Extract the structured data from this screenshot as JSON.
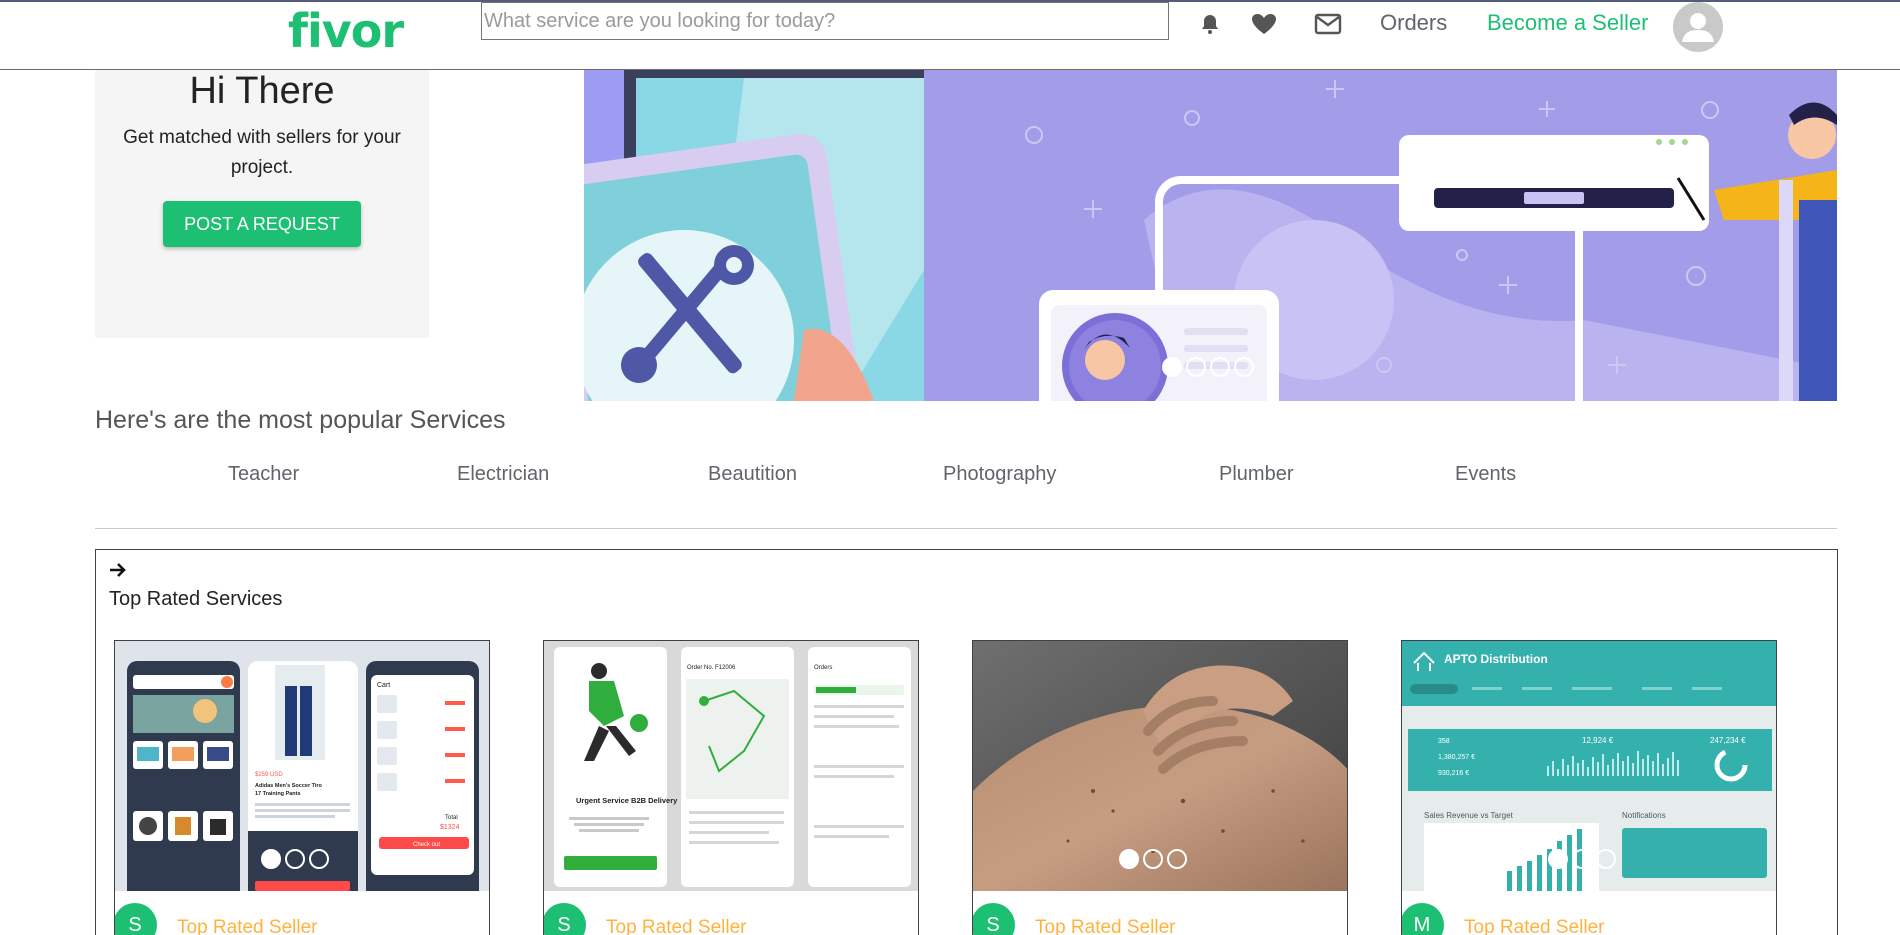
{
  "header": {
    "logo": "fivor",
    "search_placeholder": "What service are you looking for today?",
    "icons": [
      "bell-icon",
      "heart-icon",
      "mail-icon"
    ],
    "orders_label": "Orders",
    "become_seller_label": "Become a Seller",
    "brand_color": "#1dbf73"
  },
  "hero": {
    "title": "Hi There",
    "subtitle": "Get matched with sellers for your project.",
    "button_label": "POST A REQUEST",
    "slides": 4,
    "active_slide": 0
  },
  "popular": {
    "title": "Here's are the most popular Services",
    "categories": [
      "Teacher",
      "Electrician",
      "Beautition",
      "Photography",
      "Plumber",
      "Events"
    ]
  },
  "top_rated": {
    "title": "Top Rated Services",
    "cards": [
      {
        "avatar": "S",
        "label": "Top Rated Seller",
        "avatar_color": "#1dbf73"
      },
      {
        "avatar": "S",
        "label": "Top Rated Seller",
        "avatar_color": "#1dbf73"
      },
      {
        "avatar": "S",
        "label": "Top Rated Seller",
        "avatar_color": "#1dbf73"
      },
      {
        "avatar": "M",
        "label": "Top Rated Seller",
        "avatar_color": "#1dbf73"
      }
    ],
    "analytics_card": {
      "brand": "APTO Distribution",
      "kpi_1": "358",
      "kpi_2": "1,380,257 €",
      "kpi_3": "930,216 €",
      "kpi_4": "12,924 €",
      "kpi_5": "247,234 €",
      "chart_title": "Sales Revenue vs Target",
      "notifications": "Notifications"
    },
    "shop_card": {
      "cart_title": "Cart",
      "price": "$259 USD",
      "product": "Adidas Men's Soccer Tiro 17 Training Pants",
      "total_label": "Total",
      "total": "$1324",
      "checkout": "Check out"
    },
    "delivery_card": {
      "headline": "Urgent Service B2B Delivery",
      "order": "Order No. F12006",
      "orders": "Orders"
    }
  }
}
